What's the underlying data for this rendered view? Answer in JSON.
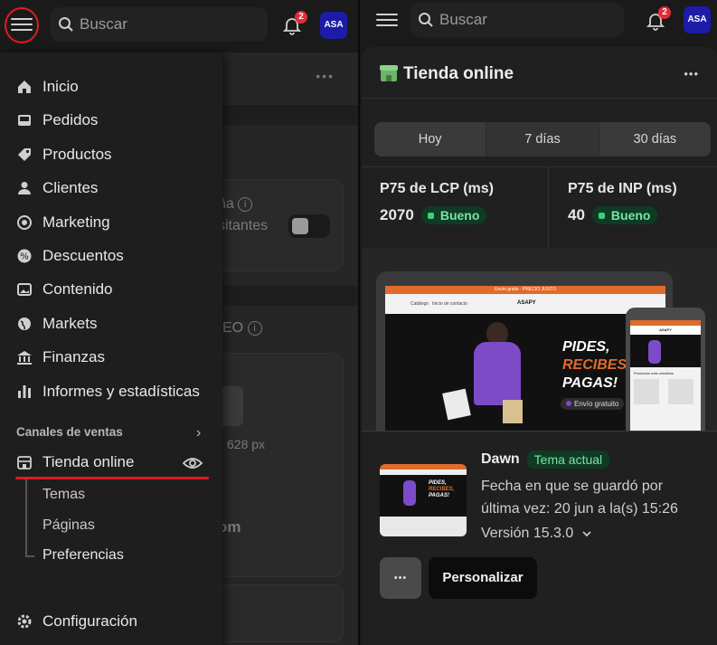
{
  "left": {
    "search_placeholder": "Buscar",
    "notif_count": "2",
    "avatar": "ASA",
    "menu": [
      {
        "label": "Inicio",
        "icon": "home-icon"
      },
      {
        "label": "Pedidos",
        "icon": "inbox-icon"
      },
      {
        "label": "Productos",
        "icon": "tag-icon"
      },
      {
        "label": "Clientes",
        "icon": "person-icon"
      },
      {
        "label": "Marketing",
        "icon": "target-icon"
      },
      {
        "label": "Descuentos",
        "icon": "discount-icon"
      },
      {
        "label": "Contenido",
        "icon": "image-icon"
      },
      {
        "label": "Markets",
        "icon": "globe-icon"
      },
      {
        "label": "Finanzas",
        "icon": "bank-icon"
      },
      {
        "label": "Informes y estadísticas",
        "icon": "bar-chart-icon"
      }
    ],
    "sales_channels_label": "Canales de ventas",
    "online_store_label": "Tienda online",
    "submenu": [
      "Temas",
      "Páginas",
      "Preferencias"
    ],
    "settings_label": "Configuración",
    "background_fragments": {
      "campaign_frag": "ña",
      "visitors_frag": "sitantes",
      "seo_frag": "EO",
      "size_frag": "628 px",
      "om_frag": "om"
    }
  },
  "right": {
    "search_placeholder": "Buscar",
    "notif_count": "2",
    "avatar": "ASA",
    "title": "Tienda online",
    "more_label": "•••",
    "tabs": [
      "Hoy",
      "7 días",
      "30 días"
    ],
    "metrics": [
      {
        "label": "P75 de LCP (ms)",
        "value": "2070",
        "status": "Bueno"
      },
      {
        "label": "P75 de INP (ms)",
        "value": "40",
        "status": "Bueno"
      }
    ],
    "preview": {
      "topstrip": "Envío gratis · PRECIO JUSTO",
      "brand": "ASAPY",
      "nav": [
        "Catálogo",
        "Inicio de contacto"
      ],
      "headline": [
        "PIDES,",
        "RECIBES,",
        "PAGAS!"
      ],
      "shipping": "Envío gratuito",
      "mobile_caption": "Productos más vendidos"
    },
    "theme": {
      "name": "Dawn",
      "badge": "Tema actual",
      "saved_line1": "Fecha en que se guardó por",
      "saved_line2": "última vez: 20 jun a la(s) 15:26",
      "version": "Versión 15.3.0",
      "more_label": "•••",
      "customize_label": "Personalizar"
    }
  }
}
